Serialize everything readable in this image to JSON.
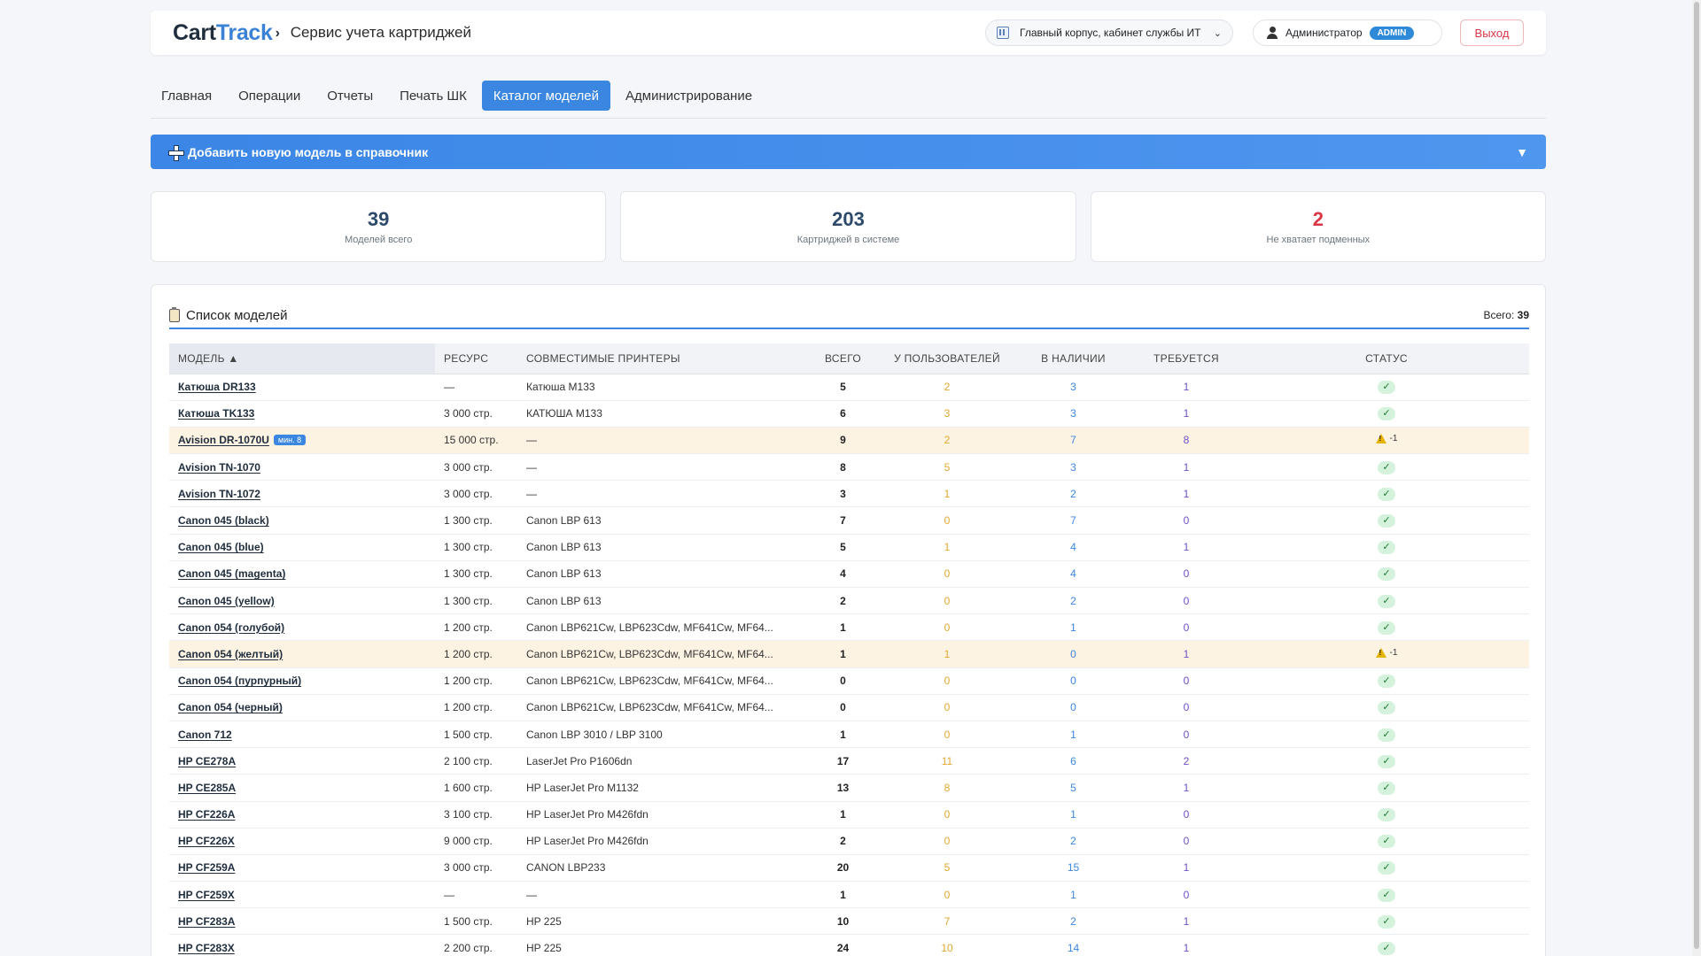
{
  "header": {
    "logo_part1": "Cart",
    "logo_part2": "Track",
    "logo_chevron": "›",
    "app_title": "Сервис учета картриджей",
    "location": "Главный корпус, кабинет службы ИТ",
    "user_name": "Администратор",
    "user_role": "ADMIN",
    "logout_label": "Выход"
  },
  "nav": {
    "items": [
      "Главная",
      "Операции",
      "Отчеты",
      "Печать ШК",
      "Каталог моделей",
      "Администрирование"
    ],
    "active_index": 4
  },
  "add_panel": {
    "label": "Добавить новую модель в справочник",
    "toggle": "▼"
  },
  "stats": [
    {
      "value": "39",
      "label": "Моделей всего"
    },
    {
      "value": "203",
      "label": "Картриджей в системе"
    },
    {
      "value": "2",
      "label": "Не хватает подменных",
      "color": "#dc3545"
    }
  ],
  "list": {
    "title": "Список моделей",
    "total_label": "Всего:",
    "total_value": "39",
    "columns": [
      "Модель ▲",
      "Ресурс",
      "Совместимые принтеры",
      "Всего",
      "У пользователей",
      "В наличии",
      "Требуется",
      "Статус"
    ],
    "rows": [
      {
        "model": "Катюша DR133",
        "resource": "—",
        "printers": "Катюша M133",
        "total": "5",
        "users": "2",
        "stock": "3",
        "required": "1",
        "status": "ok"
      },
      {
        "model": "Катюша TK133",
        "resource": "3 000 стр.",
        "printers": "КАТЮША М133",
        "total": "6",
        "users": "3",
        "stock": "3",
        "required": "1",
        "status": "ok"
      },
      {
        "model": "Avision DR-1070U",
        "badge": "мин. 8",
        "resource": "15 000 стр.",
        "printers": "—",
        "total": "9",
        "users": "2",
        "stock": "7",
        "required": "8",
        "status": "warn",
        "status_text": "-1"
      },
      {
        "model": "Avision TN-1070",
        "resource": "3 000 стр.",
        "printers": "—",
        "total": "8",
        "users": "5",
        "stock": "3",
        "required": "1",
        "status": "ok"
      },
      {
        "model": "Avision TN-1072",
        "resource": "3 000 стр.",
        "printers": "—",
        "total": "3",
        "users": "1",
        "stock": "2",
        "required": "1",
        "status": "ok"
      },
      {
        "model": "Canon 045 (black)",
        "resource": "1 300 стр.",
        "printers": "Canon LBP 613",
        "total": "7",
        "users": "0",
        "stock": "7",
        "required": "0",
        "status": "ok"
      },
      {
        "model": "Canon 045 (blue)",
        "resource": "1 300 стр.",
        "printers": "Canon LBP 613",
        "total": "5",
        "users": "1",
        "stock": "4",
        "required": "1",
        "status": "ok"
      },
      {
        "model": "Canon 045 (magenta)",
        "resource": "1 300 стр.",
        "printers": "Canon LBP 613",
        "total": "4",
        "users": "0",
        "stock": "4",
        "required": "0",
        "status": "ok"
      },
      {
        "model": "Canon 045 (yellow)",
        "resource": "1 300 стр.",
        "printers": "Canon LBP 613",
        "total": "2",
        "users": "0",
        "stock": "2",
        "required": "0",
        "status": "ok"
      },
      {
        "model": "Canon 054 (голубой)",
        "resource": "1 200 стр.",
        "printers": "Canon LBP621Cw, LBP623Cdw, MF641Cw, MF64...",
        "total": "1",
        "users": "0",
        "stock": "1",
        "required": "0",
        "status": "ok"
      },
      {
        "model": "Canon 054 (желтый)",
        "resource": "1 200 стр.",
        "printers": "Canon LBP621Cw, LBP623Cdw, MF641Cw, MF64...",
        "total": "1",
        "users": "1",
        "stock": "0",
        "required": "1",
        "status": "warn",
        "status_text": "-1"
      },
      {
        "model": "Canon 054 (пурпурный)",
        "resource": "1 200 стр.",
        "printers": "Canon LBP621Cw, LBP623Cdw, MF641Cw, MF64...",
        "total": "0",
        "users": "0",
        "stock": "0",
        "required": "0",
        "status": "ok"
      },
      {
        "model": "Canon 054 (черный)",
        "resource": "1 200 стр.",
        "printers": "Canon LBP621Cw, LBP623Cdw, MF641Cw, MF64...",
        "total": "0",
        "users": "0",
        "stock": "0",
        "required": "0",
        "status": "ok"
      },
      {
        "model": "Canon 712",
        "resource": "1 500 стр.",
        "printers": "Canon LBP 3010 / LBP 3100",
        "total": "1",
        "users": "0",
        "stock": "1",
        "required": "0",
        "status": "ok"
      },
      {
        "model": "HP CE278A",
        "resource": "2 100 стр.",
        "printers": "LaserJet Pro P1606dn",
        "total": "17",
        "users": "11",
        "stock": "6",
        "required": "2",
        "status": "ok"
      },
      {
        "model": "HP CE285A",
        "resource": "1 600 стр.",
        "printers": "HP LaserJet Pro M1132",
        "total": "13",
        "users": "8",
        "stock": "5",
        "required": "1",
        "status": "ok"
      },
      {
        "model": "HP CF226A",
        "resource": "3 100 стр.",
        "printers": "HP LaserJet Pro M426fdn",
        "total": "1",
        "users": "0",
        "stock": "1",
        "required": "0",
        "status": "ok"
      },
      {
        "model": "HP CF226X",
        "resource": "9 000 стр.",
        "printers": "HP LaserJet Pro M426fdn",
        "total": "2",
        "users": "0",
        "stock": "2",
        "required": "0",
        "status": "ok"
      },
      {
        "model": "HP CF259A",
        "resource": "3 000 стр.",
        "printers": "CANON LBP233",
        "total": "20",
        "users": "5",
        "stock": "15",
        "required": "1",
        "status": "ok"
      },
      {
        "model": "HP CF259X",
        "resource": "—",
        "printers": "—",
        "total": "1",
        "users": "0",
        "stock": "1",
        "required": "0",
        "status": "ok"
      },
      {
        "model": "HP CF283A",
        "resource": "1 500 стр.",
        "printers": "HP 225",
        "total": "10",
        "users": "7",
        "stock": "2",
        "required": "1",
        "status": "ok"
      },
      {
        "model": "HP CF283X",
        "resource": "2 200 стр.",
        "printers": "HP 225",
        "total": "24",
        "users": "10",
        "stock": "14",
        "required": "1",
        "status": "ok"
      }
    ]
  },
  "icons": {
    "location": "building-icon",
    "user": "user-icon",
    "add": "plus-icon",
    "list": "clipboard-icon",
    "ok": "check-icon",
    "warn": "warning-icon"
  },
  "colors": {
    "accent": "#3b86e0",
    "danger": "#dc3545",
    "warn_row": "#fdf3e3",
    "users": "#e0a82e",
    "stock": "#3b86e0",
    "required": "#6f4fc6"
  }
}
